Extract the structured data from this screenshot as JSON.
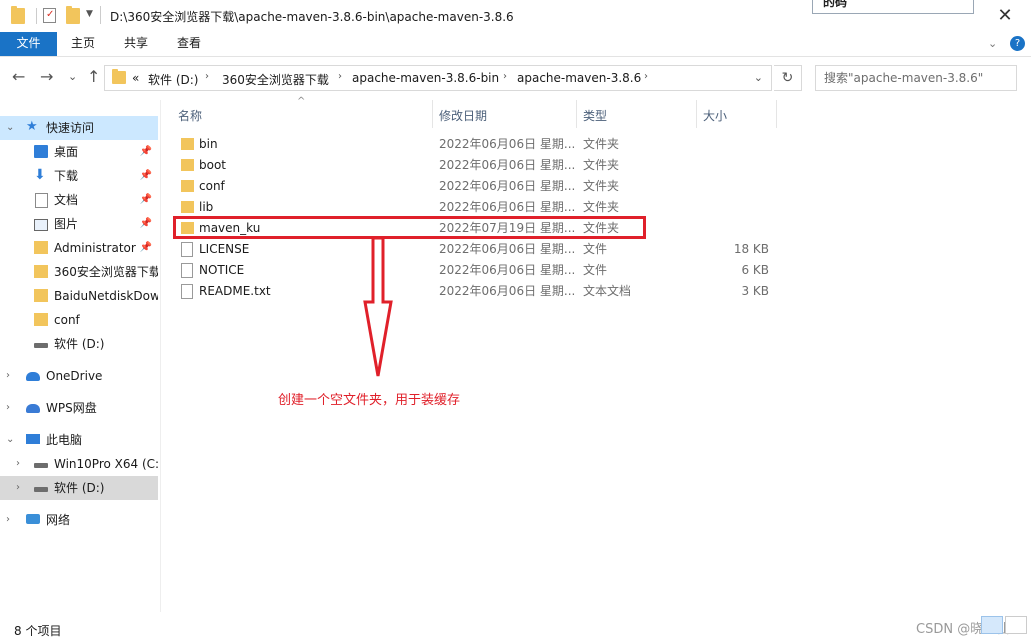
{
  "window": {
    "title": "D:\\360安全浏览器下载\\apache-maven-3.8.6-bin\\apache-maven-3.8.6",
    "close": "✕",
    "popup_text": "的码"
  },
  "ribbon": {
    "tabs": [
      "文件",
      "主页",
      "共享",
      "查看"
    ],
    "chevron": "⌄",
    "help": "?"
  },
  "nav": {
    "back": "←",
    "forward": "→",
    "recent": "⌄",
    "up": "↑",
    "breadcrumb_overflow": "«",
    "breadcrumbs": [
      "软件 (D:)",
      "360安全浏览器下载",
      "apache-maven-3.8.6-bin",
      "apache-maven-3.8.6"
    ],
    "separator": "›",
    "dropdown": "⌄",
    "refresh": "↻",
    "search_placeholder": "搜索\"apache-maven-3.8.6\""
  },
  "sidebar": {
    "items": [
      {
        "label": "快速访问",
        "icon": "star-icon",
        "chevron": "⌄",
        "selected": true
      },
      {
        "label": "桌面",
        "icon": "desktop-icon",
        "pin": "📌"
      },
      {
        "label": "下载",
        "icon": "download-icon",
        "pin": "📌"
      },
      {
        "label": "文档",
        "icon": "document-icon",
        "pin": "📌"
      },
      {
        "label": "图片",
        "icon": "picture-icon",
        "pin": "📌"
      },
      {
        "label": "Administrator",
        "icon": "folder-icon",
        "pin": "📌"
      },
      {
        "label": "360安全浏览器下载",
        "icon": "folder-icon"
      },
      {
        "label": "BaiduNetdiskDownload",
        "icon": "folder-icon"
      },
      {
        "label": "conf",
        "icon": "folder-icon"
      },
      {
        "label": "软件 (D:)",
        "icon": "drive-icon"
      },
      {
        "label": "OneDrive",
        "icon": "cloud-icon",
        "chevron": "›"
      },
      {
        "label": "WPS网盘",
        "icon": "wps-cloud-icon",
        "chevron": "›"
      },
      {
        "label": "此电脑",
        "icon": "computer-icon",
        "chevron": "⌄"
      },
      {
        "label": "Win10Pro X64 (C:)",
        "icon": "drive-icon",
        "chevron": "›"
      },
      {
        "label": "软件 (D:)",
        "icon": "drive-icon",
        "chevron": "›",
        "selected_gray": true
      },
      {
        "label": "网络",
        "icon": "network-icon",
        "chevron": "›"
      }
    ]
  },
  "files": {
    "columns": {
      "name": "名称",
      "date": "修改日期",
      "type": "类型",
      "size": "大小"
    },
    "sort_indicator": "^",
    "rows": [
      {
        "name": "bin",
        "date": "2022年06月06日 星期...",
        "type": "文件夹",
        "size": "",
        "kind": "folder"
      },
      {
        "name": "boot",
        "date": "2022年06月06日 星期...",
        "type": "文件夹",
        "size": "",
        "kind": "folder"
      },
      {
        "name": "conf",
        "date": "2022年06月06日 星期...",
        "type": "文件夹",
        "size": "",
        "kind": "folder"
      },
      {
        "name": "lib",
        "date": "2022年06月06日 星期...",
        "type": "文件夹",
        "size": "",
        "kind": "folder"
      },
      {
        "name": "maven_ku",
        "date": "2022年07月19日 星期...",
        "type": "文件夹",
        "size": "",
        "kind": "folder"
      },
      {
        "name": "LICENSE",
        "date": "2022年06月06日 星期...",
        "type": "文件",
        "size": "18 KB",
        "kind": "file"
      },
      {
        "name": "NOTICE",
        "date": "2022年06月06日 星期...",
        "type": "文件",
        "size": "6 KB",
        "kind": "file"
      },
      {
        "name": "README.txt",
        "date": "2022年06月06日 星期...",
        "type": "文本文档",
        "size": "3 KB",
        "kind": "file"
      }
    ]
  },
  "annotation": {
    "text": "创建一个空文件夹，用于装缓存",
    "color": "#e0202a"
  },
  "status": {
    "item_count": "8 个项目",
    "watermark": "CSDN @晓码仙"
  }
}
